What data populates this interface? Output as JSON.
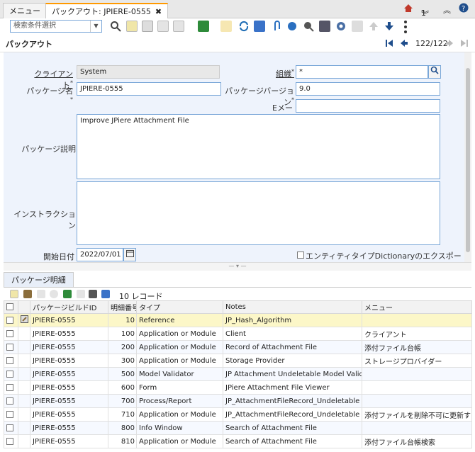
{
  "tabs": [
    {
      "label": "メニュー"
    },
    {
      "label": "パックアウト: JPIERE-0555",
      "close": "✖"
    }
  ],
  "topbar": {
    "home_icon": "home-icon",
    "user_count": "1",
    "collapse_label": "︽",
    "help_icon": "help-icon"
  },
  "toolbar": {
    "search_placeholder": "検索条件選択",
    "record_nav": "122/122"
  },
  "window_title": "パックアウト",
  "form": {
    "client_label": "クライアント",
    "client_value": "System",
    "org_label": "組織",
    "org_value": "*",
    "package_name_label": "パッケージ名",
    "package_name_value": "JPIERE-0555",
    "package_version_label": "パッケージバージョン",
    "package_version_value": "9.0",
    "email_label": "Eメール",
    "email_value": "",
    "description_label": "パッケージ説明",
    "description_value": "Improve JPiere Attachment File",
    "instructions_label": "インストラクション",
    "instructions_value": "",
    "start_date_label": "開始日付",
    "start_date_value": "2022/07/01",
    "export_dictionary_label": "エンティティタイプDictionaryのエクスポート"
  },
  "detail": {
    "tab_label": "パッケージ明細",
    "record_count": "10 レコード",
    "columns": [
      "パッケージビルドID",
      "明細番号",
      "タイプ",
      "Notes",
      "メニュー"
    ],
    "rows": [
      {
        "id": "JPIERE-0555",
        "line": "10",
        "type": "Reference",
        "notes": "JP_Hash_Algorithm",
        "menu": ""
      },
      {
        "id": "JPIERE-0555",
        "line": "100",
        "type": "Application or Module",
        "notes": "Client",
        "menu": "クライアント"
      },
      {
        "id": "JPIERE-0555",
        "line": "200",
        "type": "Application or Module",
        "notes": "Record of Attachment File",
        "menu": "添付ファイル台帳"
      },
      {
        "id": "JPIERE-0555",
        "line": "300",
        "type": "Application or Module",
        "notes": "Storage Provider",
        "menu": "ストレージプロバイダー"
      },
      {
        "id": "JPIERE-0555",
        "line": "500",
        "type": "Model Validator",
        "notes": "JP Attachment Undeletable Model Validator",
        "menu": ""
      },
      {
        "id": "JPIERE-0555",
        "line": "600",
        "type": "Form",
        "notes": "JPiere Attachment File Viewer",
        "menu": ""
      },
      {
        "id": "JPIERE-0555",
        "line": "700",
        "type": "Process/Report",
        "notes": "JP_AttachmentFileRecord_Undeletable",
        "menu": ""
      },
      {
        "id": "JPIERE-0555",
        "line": "710",
        "type": "Application or Module",
        "notes": "JP_AttachmentFileRecord_Undeletable",
        "menu": "添付ファイルを削除不可に更新する"
      },
      {
        "id": "JPIERE-0555",
        "line": "800",
        "type": "Info Window",
        "notes": "Search of Attachment File",
        "menu": ""
      },
      {
        "id": "JPIERE-0555",
        "line": "810",
        "type": "Application or Module",
        "notes": "Search of Attachment File",
        "menu": "添付ファイル台帳検索"
      }
    ]
  },
  "colors": {
    "accent": "#ff9900",
    "form_bg": "#eef3fc",
    "field_border": "#7aa7d8",
    "selected_row": "#fcf7c8"
  }
}
